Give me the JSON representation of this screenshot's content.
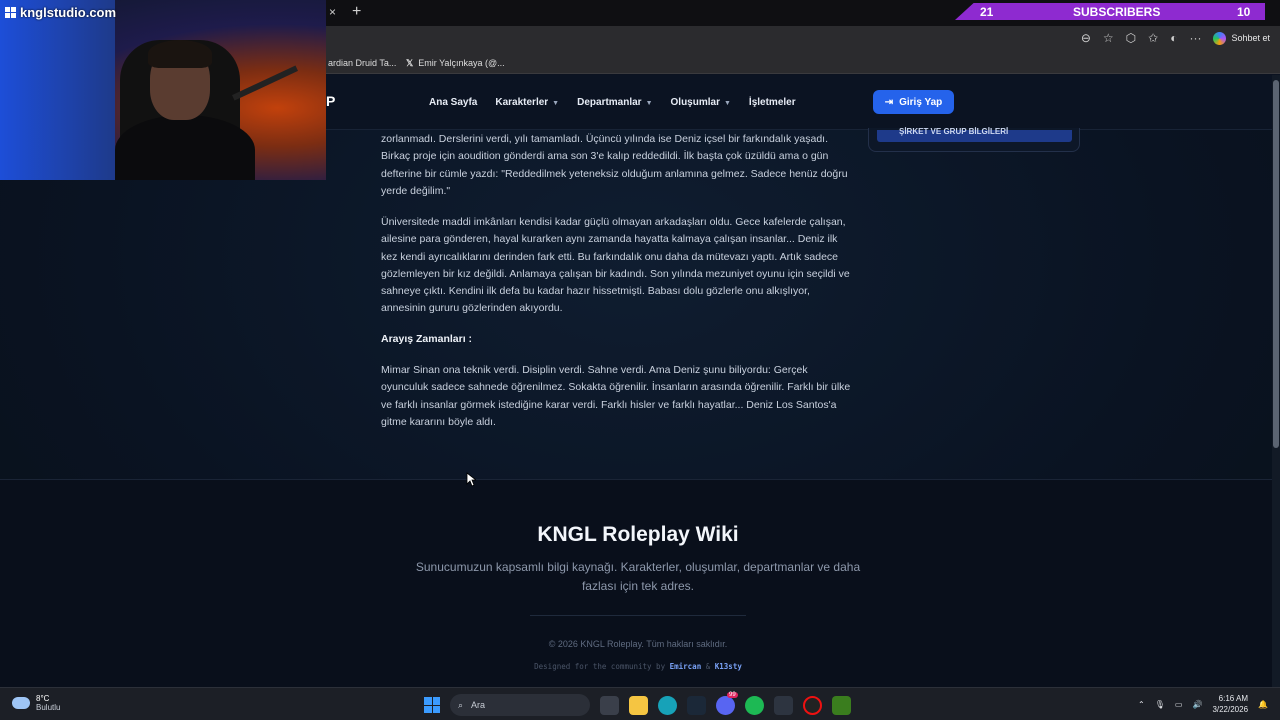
{
  "browser": {
    "close_glyph": "×",
    "new_tab_glyph": "+",
    "bookmarks": [
      {
        "label": "ardian Druid Ta..."
      },
      {
        "label": "Emir Yalçınkaya (@..."
      }
    ],
    "chat_label": "Sohbet et"
  },
  "overlay": {
    "channel": "knglstudio.com",
    "subs_left": "21",
    "subs_label": "SUBSCRIBERS",
    "subs_right": "10"
  },
  "navbar": {
    "logo": "P",
    "items": [
      {
        "label": "Ana Sayfa"
      },
      {
        "label": "Karakterler"
      },
      {
        "label": "Departmanlar"
      },
      {
        "label": "Oluşumlar"
      },
      {
        "label": "İşletmeler"
      }
    ],
    "login": "Giriş Yap"
  },
  "sidebar": {
    "partial_label": "ŞİRKET VE GRUP BİLGİLERİ"
  },
  "article": {
    "p1": "zorlanmadı. Derslerini verdi, yılı tamamladı. Üçüncü yılında ise Deniz içsel bir farkındalık yaşadı. Birkaç proje için aoudition gönderdi ama son 3'e kalıp reddedildi. İlk başta çok üzüldü ama o gün defterine bir cümle yazdı: \"Reddedilmek yeteneksiz olduğum anlamına gelmez. Sadece henüz doğru yerde değilim.\"",
    "p2": "Üniversitede maddi imkânları kendisi kadar güçlü olmayan arkadaşları oldu. Gece kafelerde çalışan, ailesine para gönderen, hayal kurarken aynı zamanda hayatta kalmaya çalışan insanlar... Deniz ilk kez kendi ayrıcalıklarını derinden fark etti. Bu farkındalık onu daha da mütevazı yaptı. Artık sadece gözlemleyen bir kız değildi. Anlamaya çalışan bir kadındı. Son yılında mezuniyet oyunu için seçildi ve sahneye çıktı. Kendini ilk defa bu kadar hazır hissetmişti. Babası dolu gözlerle onu alkışlıyor, annesinin gururu gözlerinden akıyordu.",
    "heading": "Arayış Zamanları :",
    "p3": "Mimar Sinan ona teknik verdi. Disiplin verdi. Sahne verdi. Ama Deniz şunu biliyordu: Gerçek oyunculuk sadece sahnede öğrenilmez. Sokakta öğrenilir. İnsanların arasında öğrenilir. Farklı bir ülke ve farklı insanlar görmek istediğine karar verdi. Farklı hisler ve farklı hayatlar... Deniz Los Santos'a gitme kararını böyle aldı."
  },
  "footer": {
    "title": "KNGL Roleplay Wiki",
    "description": "Sunucumuzun kapsamlı bilgi kaynağı. Karakterler, oluşumlar, departmanlar ve daha fazlası için tek adres.",
    "copyright": "© 2026 KNGL Roleplay. Tüm hakları saklıdır.",
    "credit_prefix": "Designed for the community by",
    "credit_a": "Emircan",
    "credit_amp": "&",
    "credit_b": "K13sty"
  },
  "taskbar": {
    "temp": "8°C",
    "weather": "Bulutlu",
    "search": "Ara",
    "time": "6:16 AM",
    "date": "3/22/2026",
    "badge": "99"
  }
}
